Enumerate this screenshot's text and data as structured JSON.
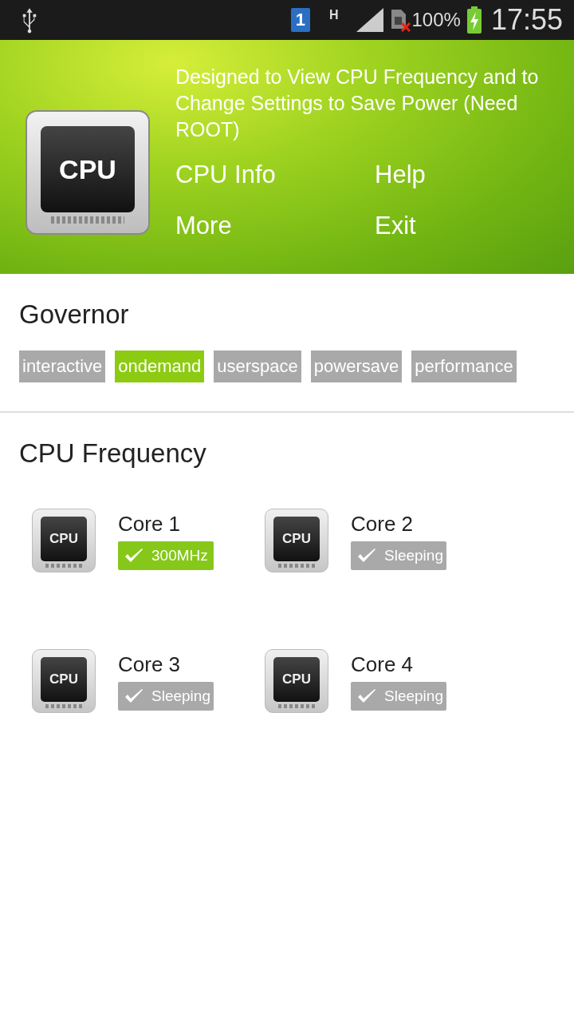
{
  "status_bar": {
    "sim_slot": "1",
    "network_type": "H",
    "battery": "100%",
    "time": "17:55"
  },
  "header": {
    "app_icon_label": "CPU",
    "description": "Designed to View CPU Frequency and to Change Settings to Save Power (Need ROOT)",
    "menu": [
      "CPU Info",
      "Help",
      "More",
      "Exit"
    ]
  },
  "governor": {
    "title": "Governor",
    "options": [
      {
        "label": "interactive",
        "selected": false
      },
      {
        "label": "ondemand",
        "selected": true
      },
      {
        "label": "userspace",
        "selected": false
      },
      {
        "label": "powersave",
        "selected": false
      },
      {
        "label": "performance",
        "selected": false
      }
    ]
  },
  "cpu_frequency": {
    "title": "CPU Frequency",
    "cores": [
      {
        "icon_label": "CPU",
        "name": "Core 1",
        "status": "300MHz",
        "active": true
      },
      {
        "icon_label": "CPU",
        "name": "Core 2",
        "status": "Sleeping",
        "active": false
      },
      {
        "icon_label": "CPU",
        "name": "Core 3",
        "status": "Sleeping",
        "active": false
      },
      {
        "icon_label": "CPU",
        "name": "Core 4",
        "status": "Sleeping",
        "active": false
      }
    ]
  }
}
